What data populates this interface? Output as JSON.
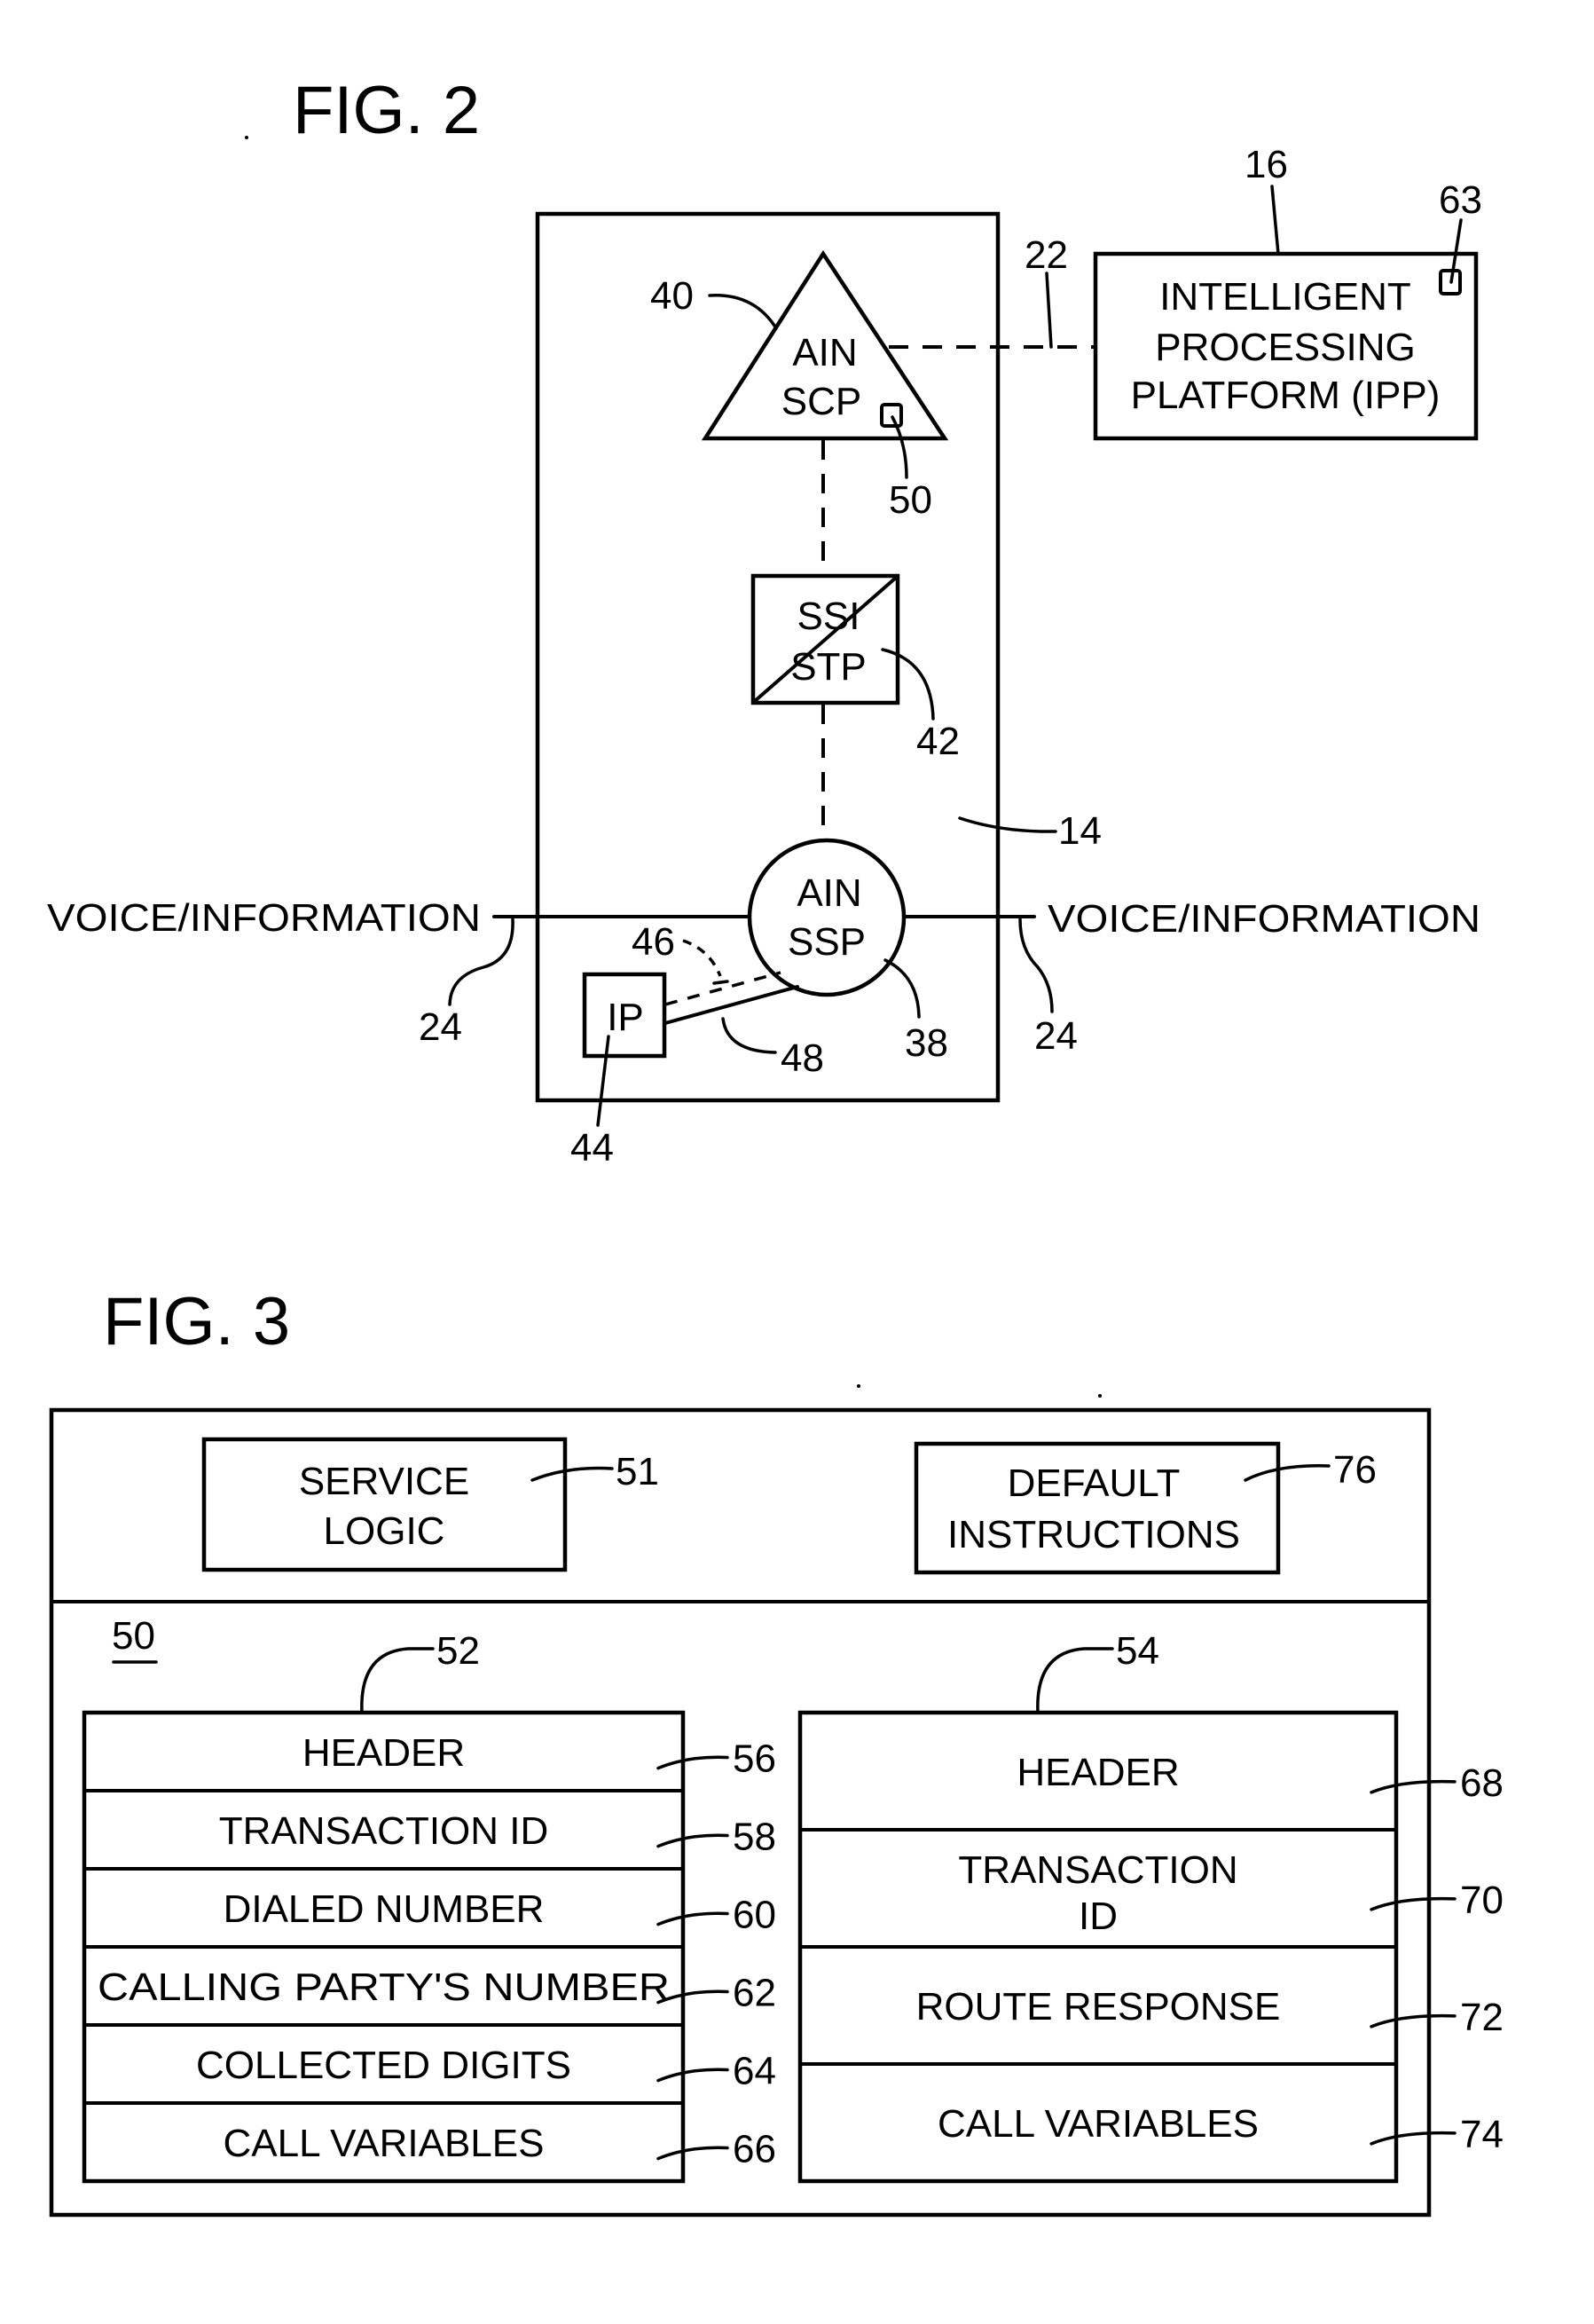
{
  "fig2": {
    "title": "FIG. 2",
    "network_ref": "14",
    "scp": {
      "line1": "AIN",
      "line2": "SCP",
      "ref": "40",
      "db_ref": "50"
    },
    "stp": {
      "line1": "SSI",
      "line2": "STP",
      "ref": "42"
    },
    "ssp": {
      "line1": "AIN",
      "line2": "SSP",
      "ref": "38"
    },
    "ip": {
      "label": "IP",
      "ref": "44",
      "data_link_ref": "46",
      "voice_link_ref": "48"
    },
    "ipp": {
      "line1": "INTELLIGENT",
      "line2": "PROCESSING",
      "line3": "PLATFORM (IPP)",
      "ref": "16",
      "module_ref": "63",
      "link_ref": "22"
    },
    "voice_left": {
      "label": "VOICE/INFORMATION",
      "ref": "24"
    },
    "voice_right": {
      "label": "VOICE/INFORMATION",
      "ref": "24"
    }
  },
  "fig3": {
    "title": "FIG. 3",
    "database_ref": "50",
    "service_logic": {
      "line1": "SERVICE",
      "line2": "LOGIC",
      "ref": "51"
    },
    "default_instructions": {
      "line1": "DEFAULT",
      "line2": "INSTRUCTIONS",
      "ref": "76"
    },
    "query_message": {
      "ref": "52",
      "rows": [
        {
          "label": "HEADER",
          "ref": "56"
        },
        {
          "label": "TRANSACTION ID",
          "ref": "58"
        },
        {
          "label": "DIALED NUMBER",
          "ref": "60"
        },
        {
          "label": "CALLING PARTY'S NUMBER",
          "ref": "62"
        },
        {
          "label": "COLLECTED DIGITS",
          "ref": "64"
        },
        {
          "label": "CALL VARIABLES",
          "ref": "66"
        }
      ]
    },
    "response_message": {
      "ref": "54",
      "rows": [
        {
          "label": "HEADER",
          "label2": "",
          "ref": "68"
        },
        {
          "label": "TRANSACTION",
          "label2": "ID",
          "ref": "70"
        },
        {
          "label": "ROUTE RESPONSE",
          "label2": "",
          "ref": "72"
        },
        {
          "label": "CALL VARIABLES",
          "label2": "",
          "ref": "74"
        }
      ]
    }
  }
}
